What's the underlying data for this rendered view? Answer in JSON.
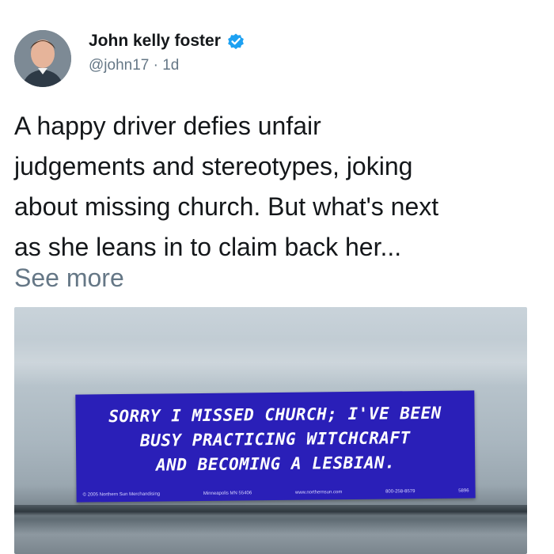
{
  "author": {
    "display_name": "John kelly foster",
    "handle": "@john17",
    "separator": "·",
    "time": "1d",
    "verified_icon": "verified-badge-icon",
    "verified_color": "#1da1f2"
  },
  "tweet": {
    "lines": [
      "A happy driver defies unfair",
      "judgements and stereotypes, joking",
      "about missing church. But what's next",
      "as she leans in to claim back her..."
    ],
    "see_more": "See more"
  },
  "media": {
    "sticker": {
      "lines": [
        "SORRY I MISSED CHURCH; I'VE BEEN",
        "BUSY PRACTICING WITCHCRAFT",
        "AND BECOMING A LESBIAN."
      ],
      "fine_print": [
        "© 2005 Northern Sun Merchandising",
        "Minneapolis MN 55406",
        "www.northernsun.com",
        "800-258-8579",
        "5896"
      ],
      "color": "#2a1fb8"
    }
  }
}
